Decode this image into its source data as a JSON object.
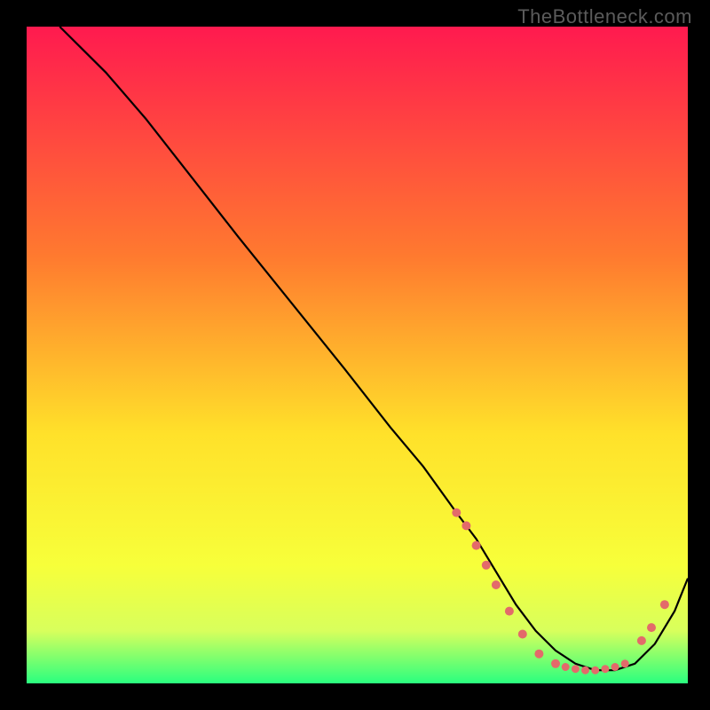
{
  "brand": {
    "watermark": "TheBottleneck.com"
  },
  "chart_data": {
    "type": "line",
    "title": "",
    "xlabel": "",
    "ylabel": "",
    "xlim": [
      0,
      100
    ],
    "ylim": [
      0,
      100
    ],
    "grid": false,
    "legend": false,
    "background_gradient": {
      "top": "#ff1a4f",
      "mid1": "#ff7a2f",
      "mid2": "#ffe12a",
      "low1": "#f7ff3a",
      "low2": "#d8ff5c",
      "bottom": "#2aff7f"
    },
    "series": [
      {
        "name": "curve",
        "color": "#000000",
        "stroke_width": 2.2,
        "x": [
          5,
          8,
          12,
          18,
          25,
          32,
          40,
          48,
          55,
          60,
          65,
          68,
          71,
          74,
          77,
          80,
          83,
          86,
          89,
          92,
          95,
          98,
          100
        ],
        "y": [
          100,
          97,
          93,
          86,
          77,
          68,
          58,
          48,
          39,
          33,
          26,
          22,
          17,
          12,
          8,
          5,
          3,
          2,
          2,
          3,
          6,
          11,
          16
        ]
      }
    ],
    "markers": {
      "color": "#e36a6a",
      "radius_small": 4.5,
      "radius_large": 6,
      "points": [
        {
          "x": 65.0,
          "y": 26.0,
          "r": 5
        },
        {
          "x": 66.5,
          "y": 24.0,
          "r": 5
        },
        {
          "x": 68.0,
          "y": 21.0,
          "r": 5
        },
        {
          "x": 69.5,
          "y": 18.0,
          "r": 5
        },
        {
          "x": 71.0,
          "y": 15.0,
          "r": 5
        },
        {
          "x": 73.0,
          "y": 11.0,
          "r": 5
        },
        {
          "x": 75.0,
          "y": 7.5,
          "r": 5
        },
        {
          "x": 77.5,
          "y": 4.5,
          "r": 5
        },
        {
          "x": 80.0,
          "y": 3.0,
          "r": 5
        },
        {
          "x": 81.5,
          "y": 2.5,
          "r": 4.5
        },
        {
          "x": 83.0,
          "y": 2.2,
          "r": 4.5
        },
        {
          "x": 84.5,
          "y": 2.0,
          "r": 4.5
        },
        {
          "x": 86.0,
          "y": 2.0,
          "r": 4.5
        },
        {
          "x": 87.5,
          "y": 2.2,
          "r": 4.5
        },
        {
          "x": 89.0,
          "y": 2.5,
          "r": 4.5
        },
        {
          "x": 90.5,
          "y": 3.0,
          "r": 4.5
        },
        {
          "x": 93.0,
          "y": 6.5,
          "r": 5
        },
        {
          "x": 94.5,
          "y": 8.5,
          "r": 5
        },
        {
          "x": 96.5,
          "y": 12.0,
          "r": 5
        }
      ]
    }
  }
}
